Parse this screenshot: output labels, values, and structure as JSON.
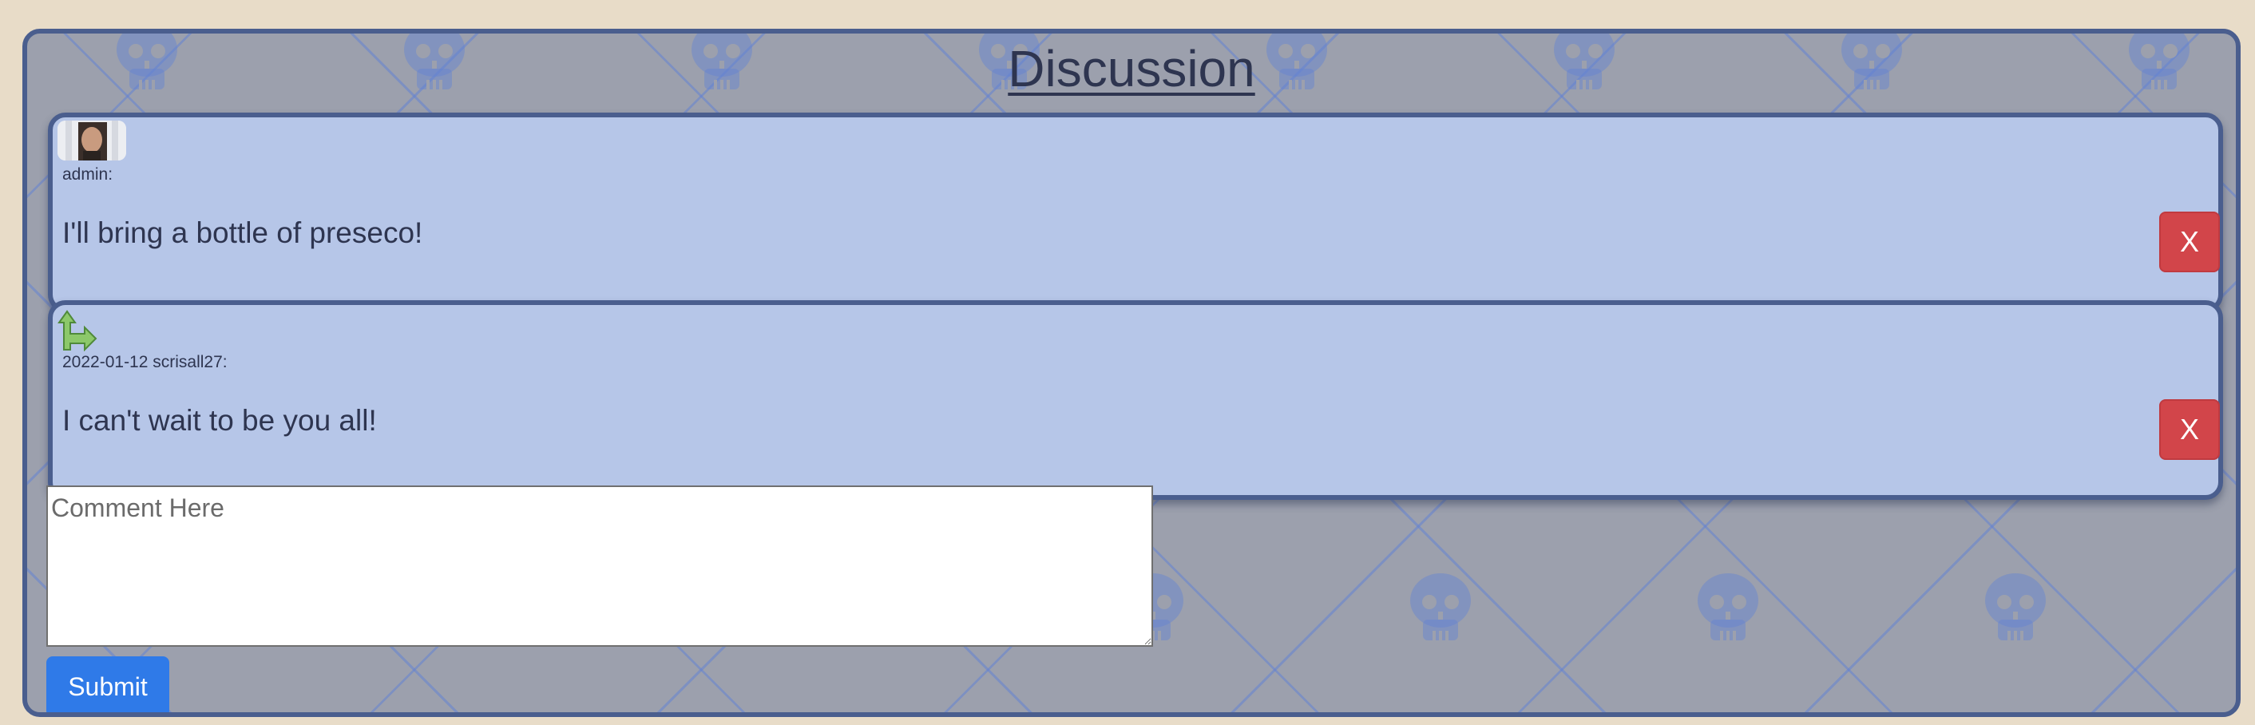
{
  "discussion": {
    "title": "Discussion",
    "comments": [
      {
        "author_line": "admin:",
        "body": "I'll bring a bottle of preseco!",
        "delete_label": "X",
        "icon": "avatar-photo"
      },
      {
        "author_line": "2022-01-12 scrisall27:",
        "body": "I can't wait to be you all!",
        "delete_label": "X",
        "icon": "reply-arrow-icon"
      }
    ],
    "comment_placeholder": "Comment Here",
    "comment_value": "",
    "submit_label": "Submit"
  },
  "colors": {
    "panel_border": "#4a5e8e",
    "comment_bg": "#b6c6e8",
    "delete_button": "#d2454a",
    "submit_button": "#2f7ae8",
    "text": "#2e3550"
  }
}
